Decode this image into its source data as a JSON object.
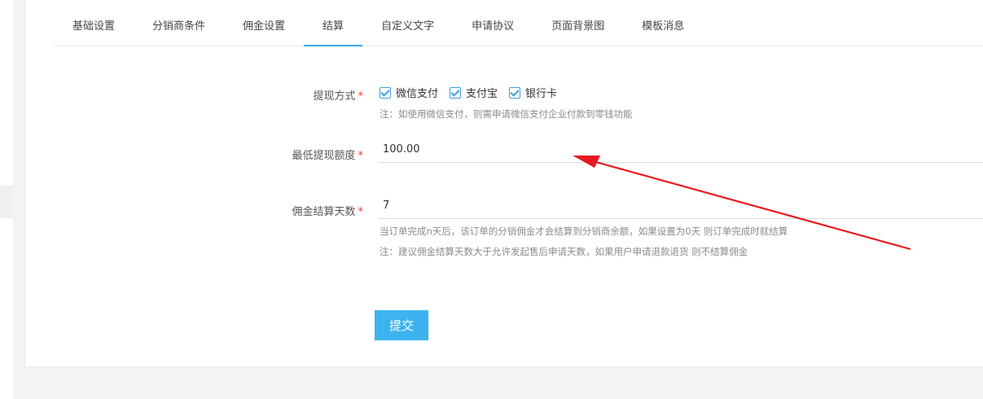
{
  "tabs": [
    {
      "label": "基础设置",
      "active": false
    },
    {
      "label": "分销商条件",
      "active": false
    },
    {
      "label": "佣金设置",
      "active": false
    },
    {
      "label": "结算",
      "active": true
    },
    {
      "label": "自定义文字",
      "active": false
    },
    {
      "label": "申请协议",
      "active": false
    },
    {
      "label": "页面背景图",
      "active": false
    },
    {
      "label": "模板消息",
      "active": false
    }
  ],
  "withdraw": {
    "label": "提现方式",
    "required_mark": "*",
    "options": [
      {
        "label": "微信支付",
        "checked": true
      },
      {
        "label": "支付宝",
        "checked": true
      },
      {
        "label": "银行卡",
        "checked": true
      }
    ],
    "note": "注：如使用微信支付，则需申请微信支付企业付款到零钱功能"
  },
  "min_amount": {
    "label": "最低提现额度",
    "required_mark": "*",
    "value": "100.00"
  },
  "settle_days": {
    "label": "佣金结算天数",
    "required_mark": "*",
    "value": "7",
    "help": "当订单完成n天后，该订单的分销佣金才会结算到分销商余额，如果设置为0天 则订单完成时就结算",
    "note": "注：建议佣金结算天数大于允许发起售后申请天数，如果用户申请退款退货 则不结算佣金"
  },
  "submit_label": "提交",
  "colors": {
    "accent": "#38a9e6",
    "button": "#3cb3ee",
    "required": "#e4393c",
    "annotation_arrow": "#e8191e"
  }
}
